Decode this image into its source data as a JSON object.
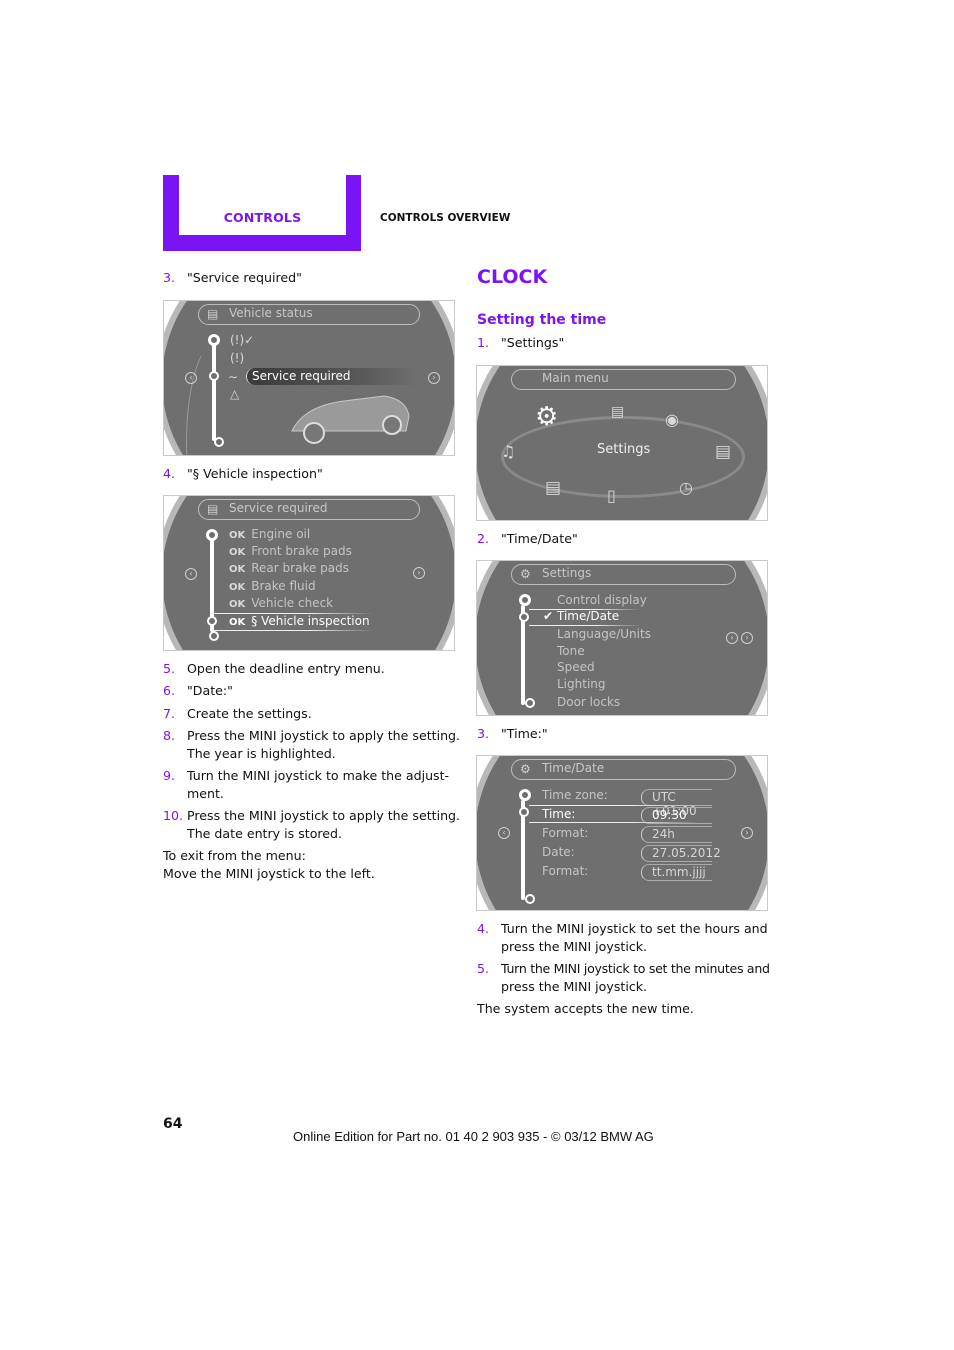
{
  "header": {
    "tab_label": "CONTROLS",
    "section_label": "CONTROLS OVERVIEW"
  },
  "colors": {
    "accent": "#7b14f5",
    "screen_bg": "#6f6f6f"
  },
  "left_column": {
    "step3": {
      "num": "3.",
      "text": "\"Service required\""
    },
    "screen1": {
      "title": "Vehicle status",
      "title_icon": "car-icon",
      "icons": [
        "tire-pressure-ok-icon",
        "tire-pressure-int-icon",
        "service-car-icon",
        "warning-triangle-icon"
      ],
      "selected_label": "Service required"
    },
    "step4": {
      "num": "4.",
      "text": "\"§ Vehicle inspection\""
    },
    "screen2": {
      "title": "Service required",
      "items": [
        {
          "status": "OK",
          "label": "Engine oil"
        },
        {
          "status": "OK",
          "label": "Front brake pads"
        },
        {
          "status": "OK",
          "label": "Rear brake pads"
        },
        {
          "status": "OK",
          "label": "Brake fluid"
        },
        {
          "status": "OK",
          "label": "Vehicle check"
        },
        {
          "status": "OK",
          "label": "§ Vehicle inspection"
        }
      ]
    },
    "steps": [
      {
        "num": "5.",
        "lines": [
          "Open the deadline entry menu."
        ]
      },
      {
        "num": "6.",
        "lines": [
          "\"Date:\""
        ]
      },
      {
        "num": "7.",
        "lines": [
          "Create the settings."
        ]
      },
      {
        "num": "8.",
        "lines": [
          "Press the MINI joystick to apply the setting.",
          "The year is highlighted."
        ]
      },
      {
        "num": "9.",
        "lines": [
          "Turn the MINI joystick to make the adjust-",
          "ment."
        ]
      },
      {
        "num": "10.",
        "lines": [
          "Press the MINI joystick to apply the setting.",
          "The date entry is stored."
        ]
      }
    ],
    "exit_line1": "To exit from the menu:",
    "exit_line2": "Move the MINI joystick to the left."
  },
  "right_column": {
    "heading": "CLOCK",
    "subheading": "Setting the time",
    "step1": {
      "num": "1.",
      "text": "\"Settings\""
    },
    "screen3": {
      "title": "Main menu",
      "center_label": "Settings",
      "icons": [
        "settings-gear-icon",
        "vehicle-icon",
        "navigation-icon",
        "manual-book-icon",
        "onboard-computer-icon",
        "phone-icon",
        "radio-icon",
        "media-icon"
      ]
    },
    "step2": {
      "num": "2.",
      "text": "\"Time/Date\""
    },
    "screen4": {
      "title": "Settings",
      "items": [
        "Control display",
        "Time/Date",
        "Language/Units",
        "Tone",
        "Speed",
        "Lighting",
        "Door locks"
      ],
      "selected_index": 1
    },
    "step3": {
      "num": "3.",
      "text": "\"Time:\""
    },
    "screen5": {
      "title": "Time/Date",
      "rows": [
        {
          "label": "Time zone:",
          "value": "UTC +01:00"
        },
        {
          "label": "Time:",
          "value": "09:30"
        },
        {
          "label": "Format:",
          "value": "24h"
        },
        {
          "label": "Date:",
          "value": "27.05.2012"
        },
        {
          "label": "Format:",
          "value": "tt.mm.jjjj"
        }
      ],
      "selected_index": 1
    },
    "steps": [
      {
        "num": "4.",
        "lines": [
          "Turn the MINI joystick to set the hours and",
          "press the MINI joystick."
        ]
      },
      {
        "num": "5.",
        "lines": [
          "Turn the MINI joystick to set the minutes and",
          "press the MINI joystick."
        ]
      }
    ],
    "closing": "The system accepts the new time."
  },
  "footer": {
    "page_number": "64",
    "edition": "Online Edition for Part no. 01 40 2 903 935 - © 03/12 BMW AG"
  }
}
